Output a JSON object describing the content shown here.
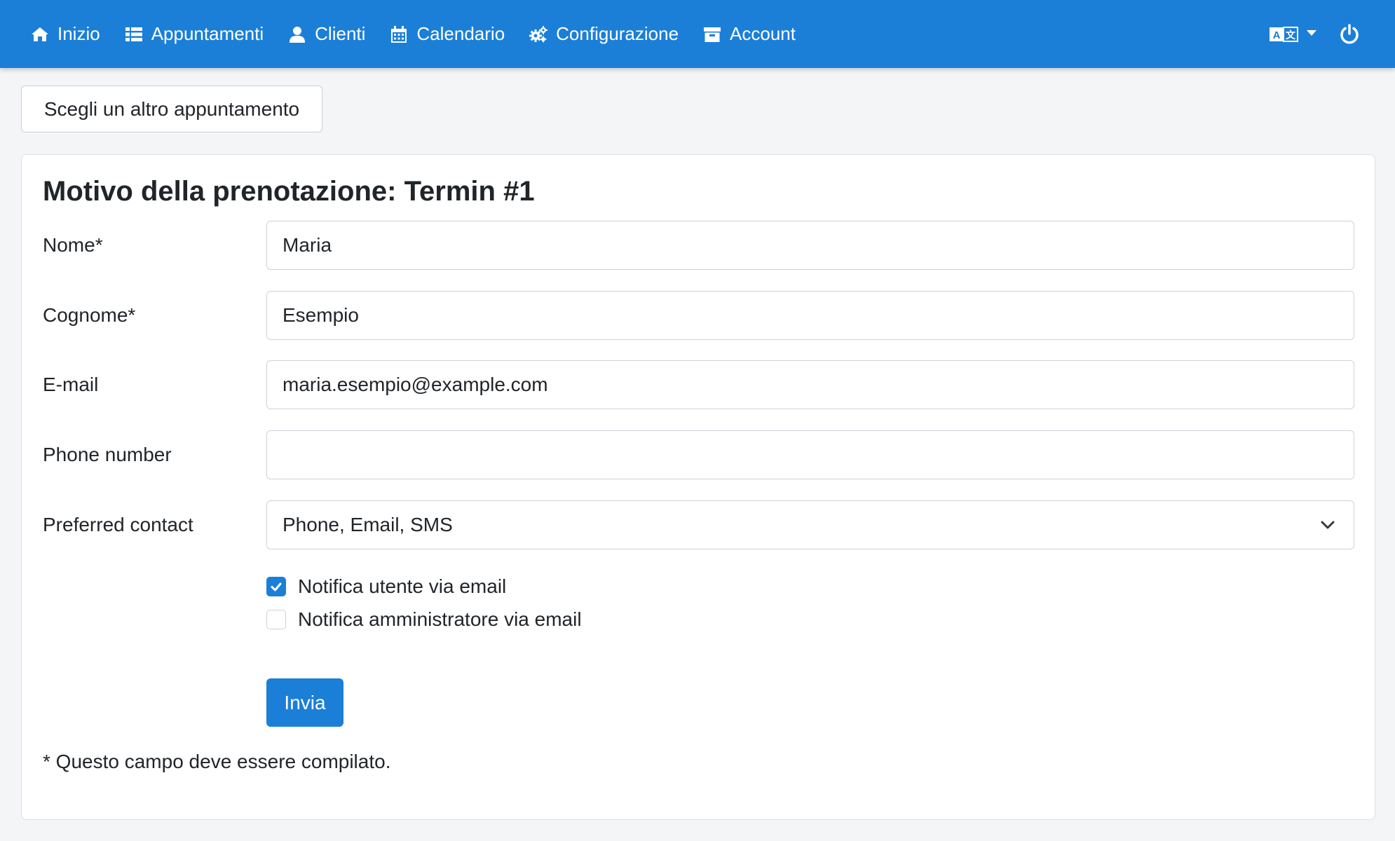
{
  "nav": {
    "items": [
      {
        "label": "Inizio",
        "icon": "home-icon"
      },
      {
        "label": "Appuntamenti",
        "icon": "list-icon"
      },
      {
        "label": "Clienti",
        "icon": "user-icon"
      },
      {
        "label": "Calendario",
        "icon": "calendar-icon"
      },
      {
        "label": "Configurazione",
        "icon": "gears-icon"
      },
      {
        "label": "Account",
        "icon": "archive-icon"
      }
    ],
    "language_icon": "language-icon",
    "power_icon": "power-icon"
  },
  "choose_other_button": "Scegli un altro appuntamento",
  "card": {
    "title": "Motivo della prenotazione: Termin #1",
    "fields": {
      "first_name": {
        "label": "Nome*",
        "value": "Maria"
      },
      "last_name": {
        "label": "Cognome*",
        "value": "Esempio"
      },
      "email": {
        "label": "E-mail",
        "value": "maria.esempio@example.com"
      },
      "phone": {
        "label": "Phone number",
        "value": ""
      },
      "preferred_contact": {
        "label": "Preferred contact",
        "value": "Phone, Email, SMS"
      }
    },
    "checkboxes": {
      "notify_user": {
        "label": "Notifica utente via email",
        "checked": true
      },
      "notify_admin": {
        "label": "Notifica amministratore via email",
        "checked": false
      }
    },
    "submit_label": "Invia",
    "required_note": "* Questo campo deve essere compilato."
  },
  "colors": {
    "primary": "#1b7fd8",
    "background": "#f4f5f7"
  }
}
